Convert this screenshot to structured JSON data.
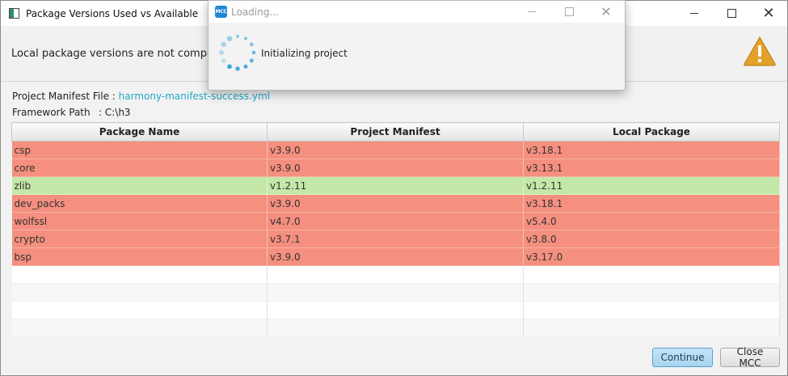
{
  "window": {
    "title": "Package Versions Used vs Available",
    "controls": {
      "minimize": "—",
      "maximize": "☐",
      "close": "✕"
    }
  },
  "message": {
    "text": "Local package versions are not compatib",
    "icon": "warning-icon",
    "icon_color": "#e3a12a"
  },
  "info": {
    "manifest_label": "Project Manifest File :",
    "manifest_value": "harmony-manifest-success.yml",
    "framework_label": "Framework Path",
    "framework_value": ": C:\\h3"
  },
  "table": {
    "headers": [
      "Package Name",
      "Project Manifest",
      "Local Package"
    ],
    "rows": [
      {
        "name": "csp",
        "manifest": "v3.9.0",
        "local": "v3.18.1",
        "status": "mismatch"
      },
      {
        "name": "core",
        "manifest": "v3.9.0",
        "local": "v3.13.1",
        "status": "mismatch"
      },
      {
        "name": "zlib",
        "manifest": "v1.2.11",
        "local": "v1.2.11",
        "status": "match"
      },
      {
        "name": "dev_packs",
        "manifest": "v3.9.0",
        "local": "v3.18.1",
        "status": "mismatch"
      },
      {
        "name": "wolfssl",
        "manifest": "v4.7.0",
        "local": "v5.4.0",
        "status": "mismatch"
      },
      {
        "name": "crypto",
        "manifest": "v3.7.1",
        "local": "v3.8.0",
        "status": "mismatch"
      },
      {
        "name": "bsp",
        "manifest": "v3.9.0",
        "local": "v3.17.0",
        "status": "mismatch"
      }
    ],
    "colors": {
      "mismatch": "#f58f7f",
      "match": "#c4e8a9"
    }
  },
  "buttons": {
    "continue": "Continue",
    "close_mcc": "Close MCC"
  },
  "loading": {
    "logo_text": "MCC",
    "title": "Loading...",
    "status": "Initializing project",
    "spinner_color": "#2aa0d6"
  }
}
